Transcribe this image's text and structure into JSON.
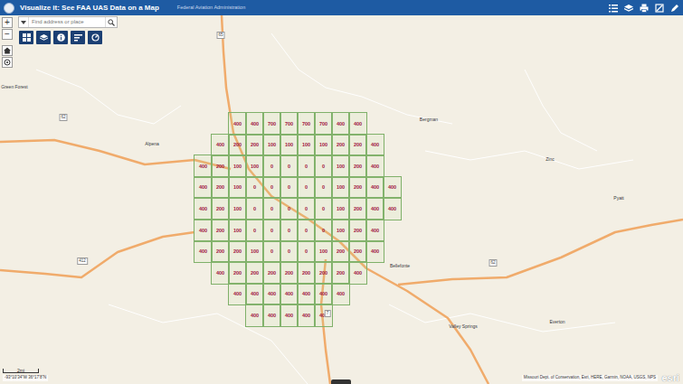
{
  "header": {
    "title": "Visualize it: See FAA UAS Data on a Map",
    "subtitle": "Federal Aviation Administration"
  },
  "search": {
    "placeholder": "Find address or place"
  },
  "zoom": {
    "in": "+",
    "out": "−"
  },
  "grid": {
    "rows": [
      {
        "cells": [
          "400",
          "400",
          "700",
          "700",
          "700",
          "700",
          "400",
          "400"
        ]
      },
      {
        "cells": [
          "400",
          "200",
          "200",
          "100",
          "100",
          "100",
          "100",
          "200",
          "200",
          "400"
        ]
      },
      {
        "cells": [
          "400",
          "200",
          "100",
          "100",
          "0",
          "0",
          "0",
          "0",
          "100",
          "200",
          "400"
        ]
      },
      {
        "cells": [
          "400",
          "200",
          "100",
          "0",
          "0",
          "0",
          "0",
          "0",
          "100",
          "200",
          "400",
          "400"
        ]
      },
      {
        "cells": [
          "400",
          "200",
          "100",
          "0",
          "0",
          "0",
          "0",
          "0",
          "100",
          "200",
          "400",
          "400"
        ]
      },
      {
        "cells": [
          "400",
          "200",
          "100",
          "0",
          "0",
          "0",
          "0",
          "0",
          "100",
          "200",
          "400"
        ]
      },
      {
        "cells": [
          "400",
          "200",
          "200",
          "100",
          "0",
          "0",
          "0",
          "100",
          "200",
          "200",
          "400"
        ]
      },
      {
        "cells": [
          "400",
          "200",
          "200",
          "200",
          "200",
          "200",
          "200",
          "200",
          "400"
        ]
      },
      {
        "cells": [
          "400",
          "400",
          "400",
          "400",
          "400",
          "400",
          "400"
        ]
      },
      {
        "cells": [
          "400",
          "400",
          "400",
          "400",
          "400"
        ]
      }
    ]
  },
  "places": [
    {
      "name": "Green Forest"
    },
    {
      "name": "Alpena"
    },
    {
      "name": "Bergman"
    },
    {
      "name": "Zinc"
    },
    {
      "name": "Pyatt"
    },
    {
      "name": "Bellefonte"
    },
    {
      "name": "Valley Springs"
    },
    {
      "name": "Everton"
    }
  ],
  "shields": [
    {
      "label": "65"
    },
    {
      "label": "62"
    },
    {
      "label": "62"
    },
    {
      "label": "412"
    },
    {
      "label": "7"
    }
  ],
  "scale": "2mi",
  "coordinates": "-93°10'34\"W 36°17'8\"N",
  "attribution": "Missouri Dept. of Conservation, Esri, HERE, Garmin, NOAA, USGS, NPS",
  "logo": "esri"
}
